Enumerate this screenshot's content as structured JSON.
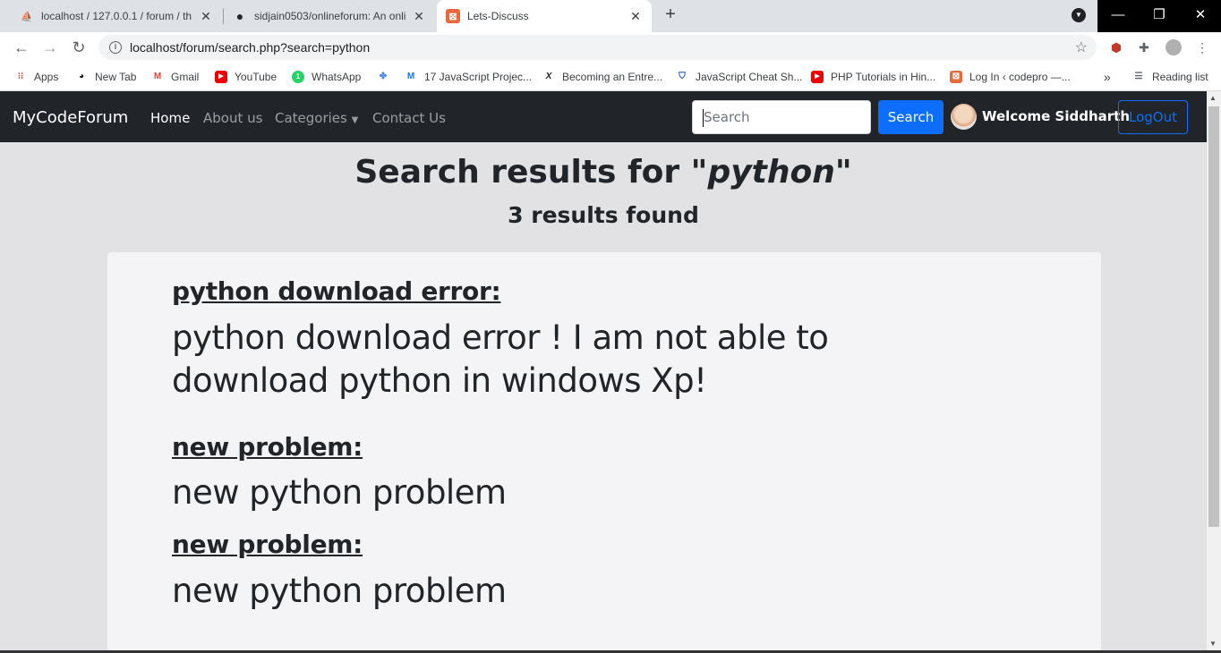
{
  "browser": {
    "tabs": [
      {
        "title": "localhost / 127.0.0.1 / forum / th",
        "icon": "phpmyadmin-icon"
      },
      {
        "title": "sidjain0503/onlineforum: An onli",
        "icon": "github-icon"
      },
      {
        "title": "Lets-Discuss",
        "icon": "codepen-icon"
      }
    ],
    "url": "localhost/forum/search.php?search=python",
    "bookmarks": [
      {
        "label": "Apps",
        "icon": "apps-grid-icon"
      },
      {
        "label": "New Tab",
        "icon": "globe-icon"
      },
      {
        "label": "Gmail",
        "icon": "gmail-icon"
      },
      {
        "label": "YouTube",
        "icon": "youtube-icon"
      },
      {
        "label": "WhatsApp",
        "icon": "whatsapp-icon"
      },
      {
        "label": "",
        "icon": "pinwheel-icon"
      },
      {
        "label": "17 JavaScript Projec...",
        "icon": "m-logo-icon"
      },
      {
        "label": "Becoming an Entre...",
        "icon": "x-logo-icon"
      },
      {
        "label": "JavaScript Cheat Sh...",
        "icon": "shield-icon"
      },
      {
        "label": "PHP Tutorials in Hin...",
        "icon": "youtube-icon"
      },
      {
        "label": "Log In ‹ codepro —...",
        "icon": "codepen-icon"
      }
    ],
    "reading_list": "Reading list",
    "overflow": "»"
  },
  "navbar": {
    "brand": "MyCodeForum",
    "links": [
      "Home",
      "About us",
      "Categories",
      "Contact Us"
    ],
    "search_placeholder": "Search",
    "search_button": "Search",
    "welcome": "Welcome Siddharth",
    "logout": "LogOut"
  },
  "results": {
    "heading_prefix": "Search results for \"",
    "query": "python",
    "heading_suffix": "\"",
    "count": "3 results found",
    "items": [
      {
        "title": "python download error:",
        "desc": "python download error ! I am not able to download python in windows Xp!"
      },
      {
        "title": "new problem:",
        "desc": "new python problem"
      },
      {
        "title": "new problem:",
        "desc": "new python problem"
      }
    ]
  },
  "colors": {
    "navbar_bg": "#212529",
    "primary": "#0d6efd"
  }
}
